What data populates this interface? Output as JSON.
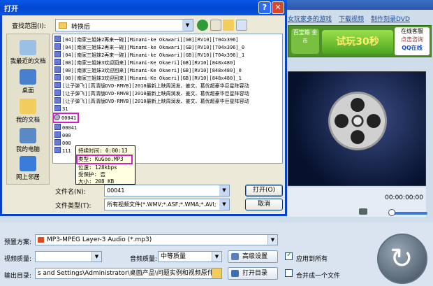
{
  "app": {
    "top_links": [
      "女玩家多的游戏",
      "下载视频",
      "制作刻录DVD"
    ],
    "ad": {
      "left_text": "百宝箱 金币",
      "middle_text": "试玩30秒",
      "right_line1": "在线客服",
      "right_line2": "点击咨询",
      "right_line3": "QQ在线"
    },
    "player": {
      "timecode": "00:00:00:00"
    }
  },
  "bottom": {
    "preset_label": "预置方案:",
    "preset_value": "MP3-MPEG Layer-3 Audio (*.mp3)",
    "video_quality_label": "视频质量:",
    "video_quality_value": "",
    "audio_quality_label": "音频质量:",
    "audio_quality_value": "中等质量",
    "advanced_label": "高级设置",
    "apply_all_label": "应用到所有",
    "output_label": "输出目录:",
    "output_value": "s and Settings\\Administrator\\桌面产品\\问题实例和视频原件\\转换",
    "open_dir_label": "打开目录",
    "merge_label": "合并成一个文件"
  },
  "dialog": {
    "title": "打开",
    "lookin_label": "查找范围(I):",
    "lookin_value": "转换后",
    "places": [
      "我最近的文档",
      "桌面",
      "我的文档",
      "我的电脑",
      "网上邻居"
    ],
    "files": [
      "[04][南家三姐妹2再来一碗][Minami-ke Okawari][GB][RV10][704x396]",
      "[04][南家三姐妹2再来一碗][Minami-ke Okawari][GB][RV10][704x396]_0",
      "[04][南家三姐妹2再来一碗][Minami-ke Okawari][GB][RV10][704x396]_1",
      "[08][南家三姐妹3欢迎回来][Minami-Ke Okaeri][GB][RV10][848x480]",
      "[08][南家三姐妹3欢迎回来][Minami-Ke Okaeri][GB][RV10][848x480]_0",
      "[08][南家三姐妹3欢迎回来][Minami-Ke Okaeri][GB][RV10][848x480]_1",
      "[让子弹飞][高清版DVD-RMVB][2010最新上映周润发、姜文、葛优超豪华巨星阵容动",
      "[让子弹飞][高清版DVD-RMVB][2010最新上映周润发、姜文、葛优超豪华巨星阵容动",
      "[让子弹飞][高清版DVD-RMVB][2010最新上映周润发、姜文、葛优超豪华巨星阵容动",
      "31",
      "00041",
      "00041",
      "000",
      "000",
      "111"
    ],
    "tooltip": {
      "duration": "持续时间: 0:00:13",
      "type": "类型: KuGoo.MP3",
      "bitrate": "位速: 128kbps",
      "protected": "受保护: 否",
      "size": "大小: 208 KB"
    },
    "filename_label": "文件名(N):",
    "filename_value": "00041",
    "filetype_label": "文件类型(T):",
    "filetype_value": "所有视频文件(*.WMV;*.ASF;*.WMA;*.AVI;",
    "open_label": "打开(O)",
    "cancel_label": "取消"
  }
}
